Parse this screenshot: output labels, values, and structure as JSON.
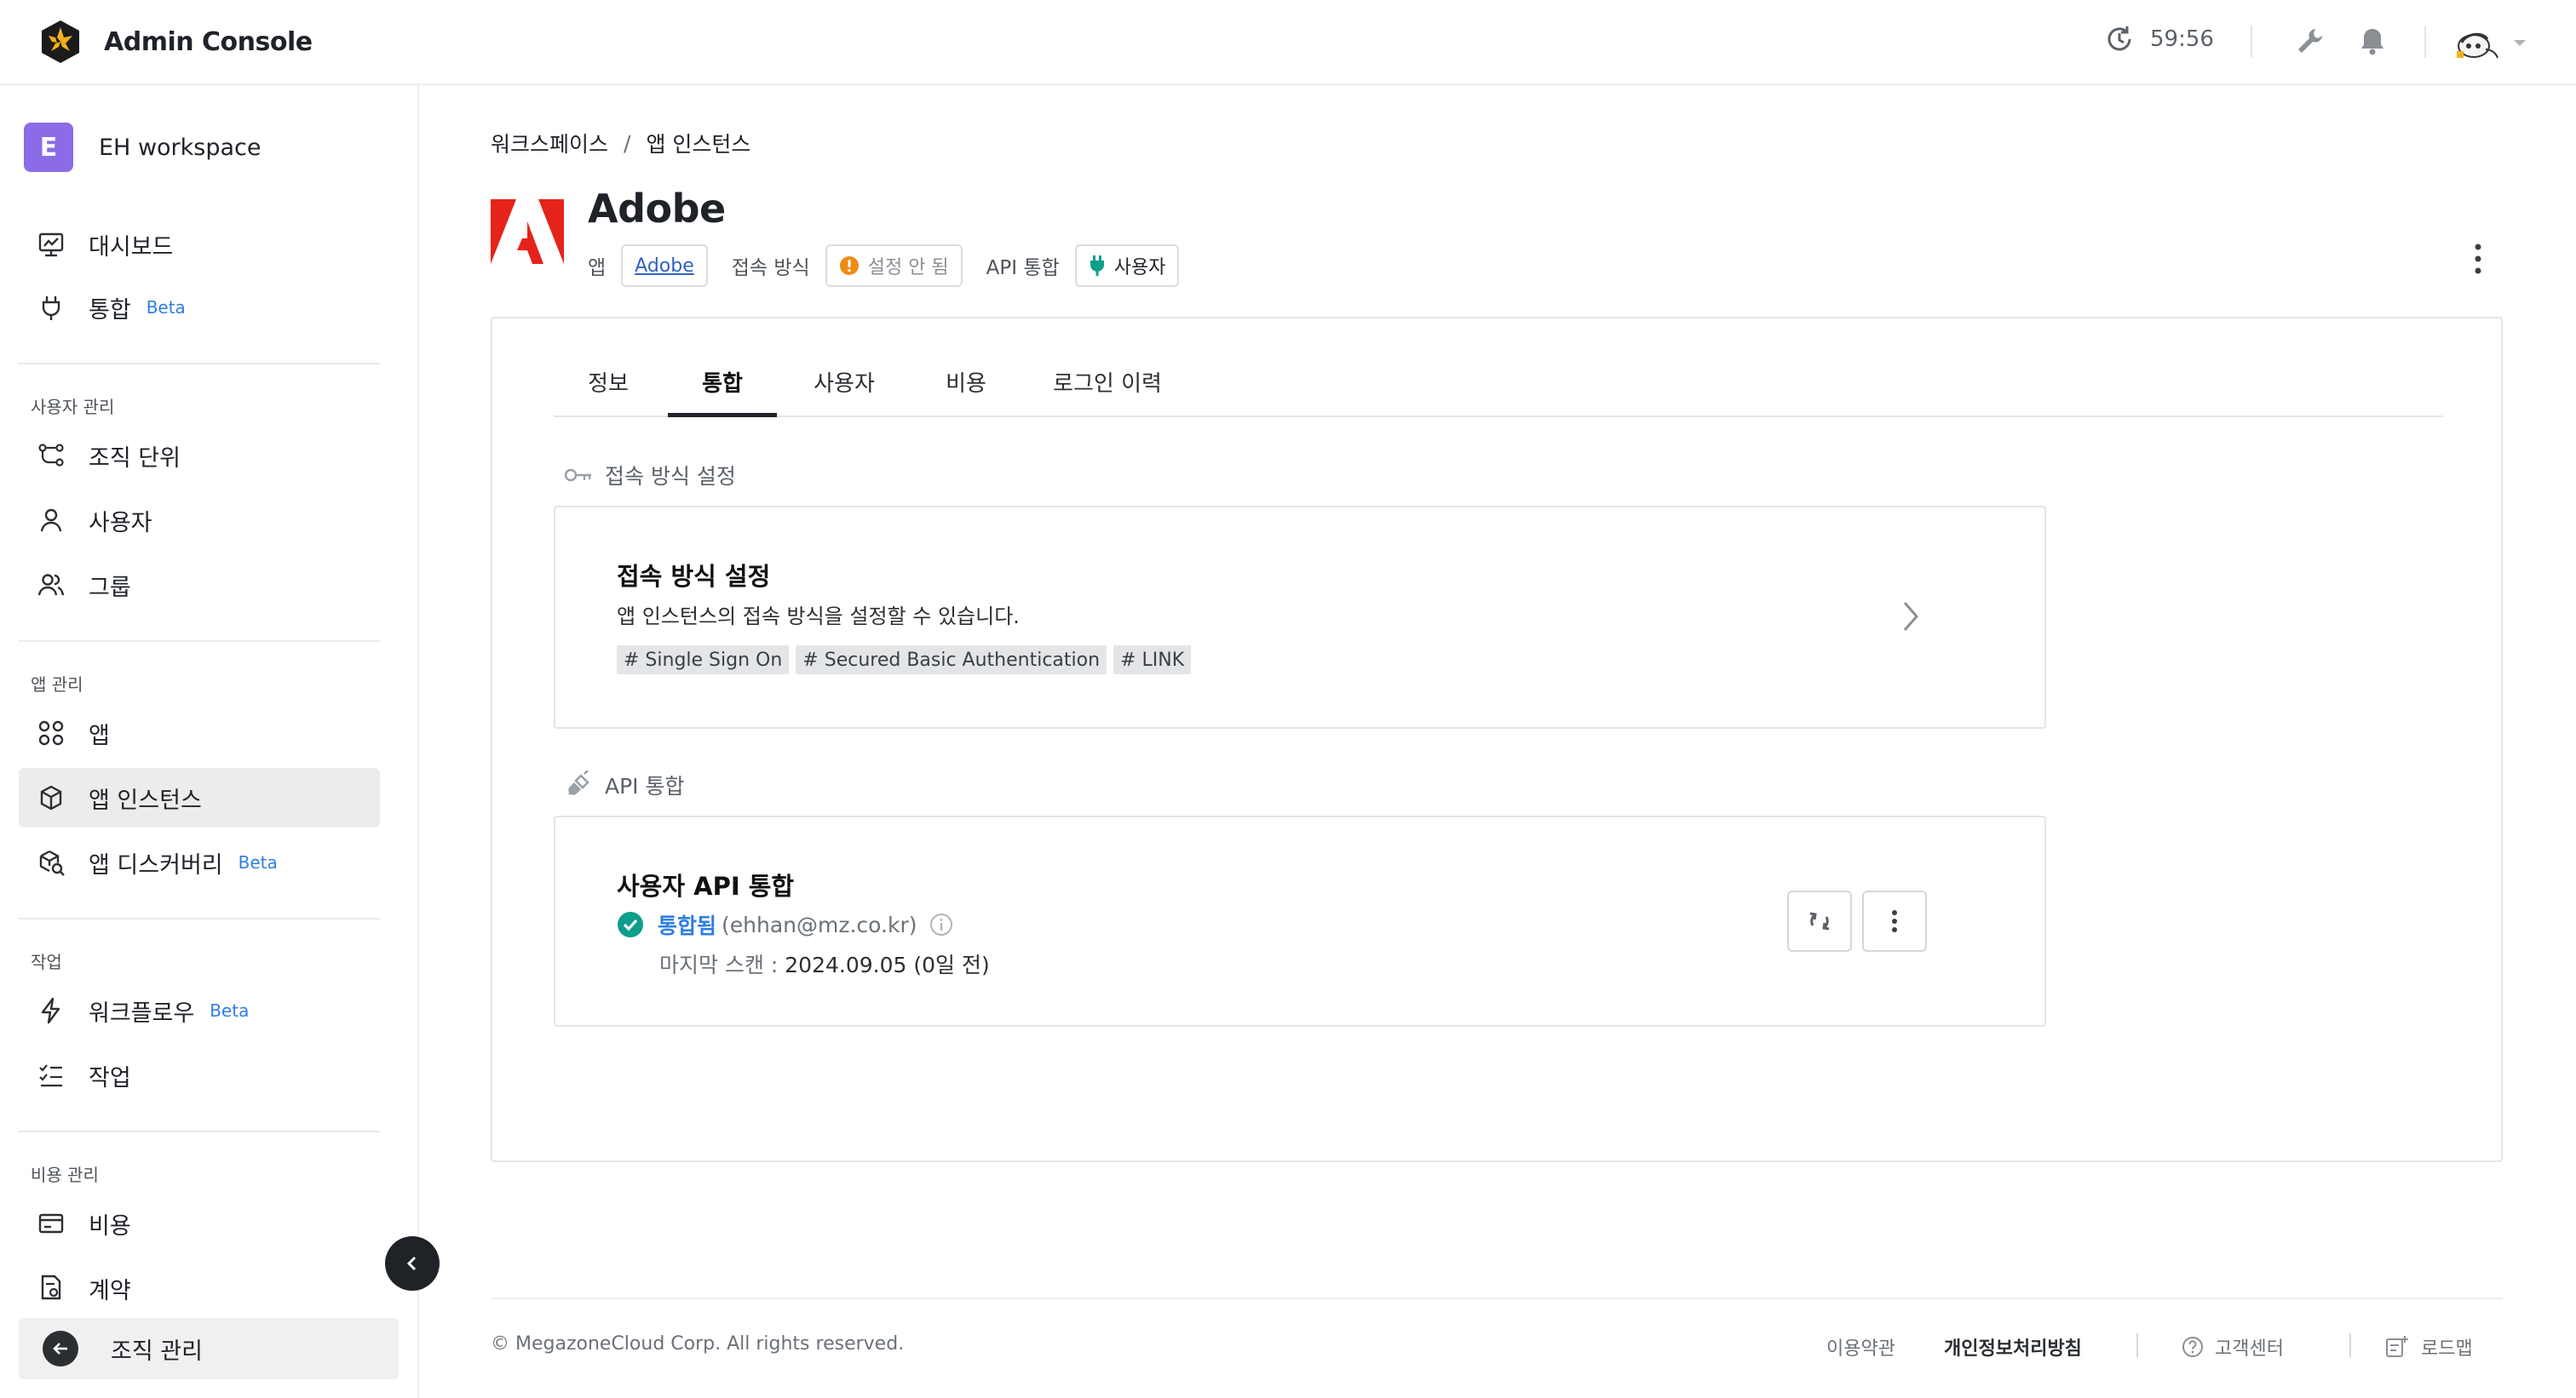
{
  "app": {
    "title": "Admin Console"
  },
  "header": {
    "session_timer": "59:56"
  },
  "sidebar": {
    "workspace": {
      "badge": "E",
      "name": "EH workspace"
    },
    "top_items": [
      {
        "label": "대시보드",
        "icon": "dashboard-icon"
      },
      {
        "label": "통합",
        "icon": "plug-icon",
        "badge": "Beta"
      }
    ],
    "sections": {
      "users": "사용자 관리",
      "apps": "앱 관리",
      "tasks": "작업",
      "cost": "비용 관리"
    },
    "user_items": [
      {
        "label": "조직 단위",
        "icon": "org-unit-icon"
      },
      {
        "label": "사용자",
        "icon": "user-icon"
      },
      {
        "label": "그룹",
        "icon": "group-icon"
      }
    ],
    "app_items": [
      {
        "label": "앱",
        "icon": "apps-grid-icon"
      },
      {
        "label": "앱 인스턴스",
        "icon": "cube-icon",
        "active": true
      },
      {
        "label": "앱 디스커버리",
        "icon": "discovery-icon",
        "badge": "Beta"
      }
    ],
    "task_items": [
      {
        "label": "워크플로우",
        "icon": "lightning-icon",
        "badge": "Beta"
      },
      {
        "label": "작업",
        "icon": "task-list-icon"
      }
    ],
    "cost_items": [
      {
        "label": "비용",
        "icon": "credit-card-icon"
      },
      {
        "label": "계약",
        "icon": "contract-icon"
      }
    ],
    "org_button": "조직 관리"
  },
  "breadcrumb": {
    "root": "워크스페이스",
    "separator": "/",
    "current": "앱 인스턴스"
  },
  "app_header": {
    "name": "Adobe",
    "app_label": "앱",
    "app_link": "Adobe",
    "access_label": "접속 방식",
    "access_value": "설정 안 됨",
    "api_label": "API 통합",
    "api_value": "사용자"
  },
  "tabs": [
    {
      "label": "정보"
    },
    {
      "label": "통합",
      "active": true
    },
    {
      "label": "사용자"
    },
    {
      "label": "비용"
    },
    {
      "label": "로그인 이력"
    }
  ],
  "access_section": {
    "heading": "접속 방식 설정",
    "card_title": "접속 방식 설정",
    "card_desc": "앱 인스턴스의 접속 방식을 설정할 수 있습니다.",
    "tags": [
      "# Single Sign On",
      "# Secured Basic Authentication",
      "# LINK"
    ]
  },
  "api_section": {
    "heading": "API 통합",
    "card_title": "사용자 API 통합",
    "status": "통합됨",
    "account": "(ehhan@mz.co.kr)",
    "scan_label": "마지막 스캔 :",
    "scan_value": "2024.09.05 (0일 전)"
  },
  "footer": {
    "copyright": "© MegazoneCloud Corp. All rights reserved.",
    "terms": "이용약관",
    "privacy": "개인정보처리방침",
    "support": "고객센터",
    "roadmap": "로드맵"
  },
  "colors": {
    "accent_blue": "#2f7fe0",
    "success_green": "#0e9e8c",
    "warning_orange": "#f08a12",
    "adobe_red": "#e5231b",
    "workspace_purple": "#8b6ce6"
  }
}
